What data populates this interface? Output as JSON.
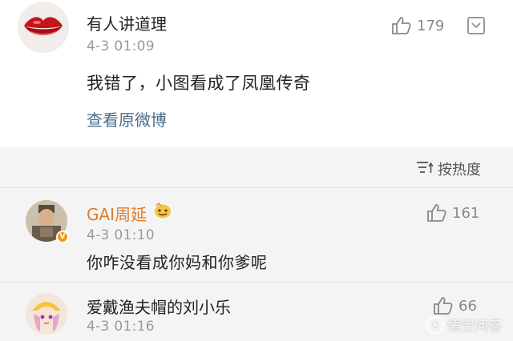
{
  "top_comment": {
    "username": "有人讲道理",
    "timestamp": "4-3 01:09",
    "text": "我错了，小图看成了凤凰传奇",
    "likes": "179",
    "view_original": "查看原微博",
    "avatar_icon": "red-lips-avatar"
  },
  "reply_section": {
    "sort_label": "按热度",
    "replies": [
      {
        "username": "GAI周延",
        "timestamp": "4-3 01:10",
        "text": "你咋没看成你妈和你爹呢",
        "likes": "161",
        "verified": true,
        "name_color": "#e07b2a"
      },
      {
        "username": "爱戴渔夫帽的刘小乐",
        "timestamp": "4-3 01:16",
        "likes": "66",
        "verified": false
      }
    ]
  },
  "watermark": {
    "text": "悟空问答"
  },
  "colors": {
    "link": "#4a6d8c",
    "muted": "#9a9a9a",
    "reply_bg": "#f4f4f4",
    "verified": "#f09a1a"
  }
}
